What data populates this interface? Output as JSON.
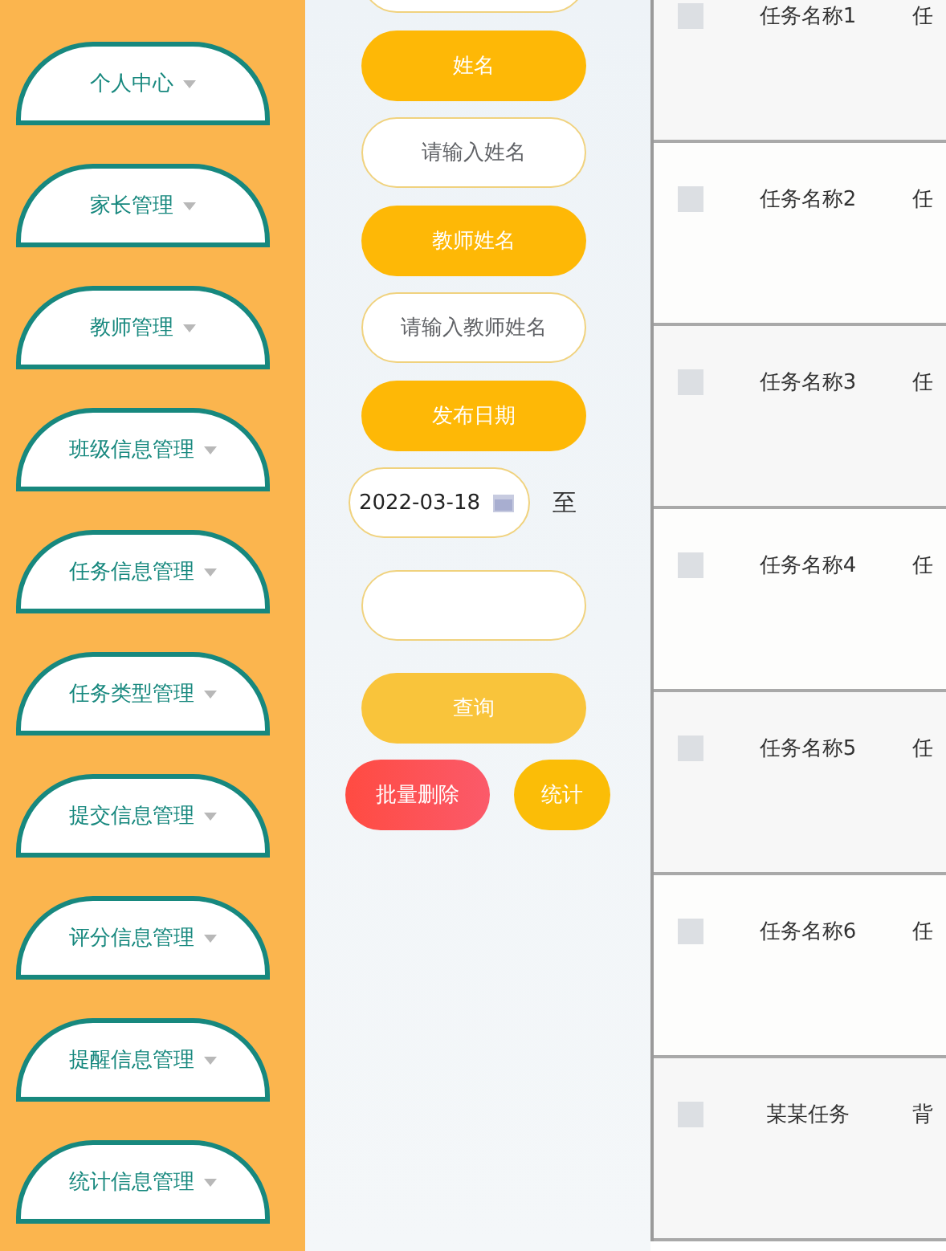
{
  "sidebar": {
    "items": [
      {
        "label": "个人中心"
      },
      {
        "label": "家长管理"
      },
      {
        "label": "教师管理"
      },
      {
        "label": "班级信息管理"
      },
      {
        "label": "任务信息管理"
      },
      {
        "label": "任务类型管理"
      },
      {
        "label": "提交信息管理"
      },
      {
        "label": "评分信息管理"
      },
      {
        "label": "提醒信息管理"
      },
      {
        "label": "统计信息管理"
      }
    ]
  },
  "search_form": {
    "items": [
      {
        "kind": "input"
      },
      {
        "kind": "label",
        "text": "姓名"
      },
      {
        "kind": "input",
        "placeholder": "请输入姓名"
      },
      {
        "kind": "label",
        "text": "教师姓名"
      },
      {
        "kind": "input",
        "placeholder": "请输入教师姓名"
      },
      {
        "kind": "label",
        "text": "发布日期"
      },
      {
        "kind": "date_range",
        "start": "2022-03-18",
        "separator": "至"
      }
    ],
    "search_button": {
      "label": "查询"
    },
    "actions": [
      {
        "kind": "danger",
        "label": "批量删除"
      },
      {
        "kind": "primary",
        "label": "统计"
      }
    ]
  },
  "table": {
    "rows": [
      {
        "checked": false,
        "column_2": "任务名称1",
        "column_3": "任"
      },
      {
        "checked": false,
        "column_2": "任务名称2",
        "column_3": "任"
      },
      {
        "checked": false,
        "column_2": "任务名称3",
        "column_3": "任"
      },
      {
        "checked": false,
        "column_2": "任务名称4",
        "column_3": "任"
      },
      {
        "checked": false,
        "column_2": "任务名称5",
        "column_3": "任"
      },
      {
        "checked": false,
        "column_2": "任务名称6",
        "column_3": "任"
      },
      {
        "checked": false,
        "column_2": "某某任务",
        "column_3": "背"
      }
    ]
  }
}
